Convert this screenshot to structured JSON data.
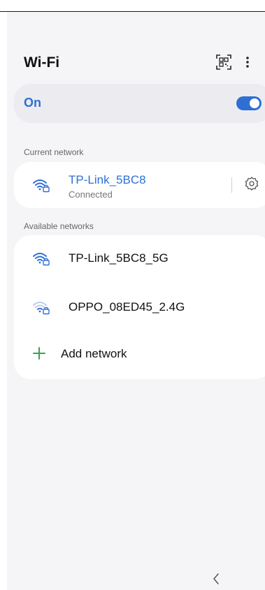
{
  "header": {
    "title": "Wi-Fi",
    "qr_icon": "qr-code-scan-icon",
    "more_icon": "more-vertical-icon"
  },
  "wifi_toggle": {
    "label": "On",
    "state": "on",
    "accent": "#2f6fd3"
  },
  "current_network": {
    "section_label": "Current network",
    "name": "TP-Link_5BC8",
    "status": "Connected",
    "icon": "wifi-lock-icon",
    "settings_icon": "gear-icon"
  },
  "available_networks": {
    "section_label": "Available networks",
    "items": [
      {
        "name": "TP-Link_5BC8_5G",
        "icon": "wifi-lock-icon"
      },
      {
        "name": "OPPO_08ED45_2.4G",
        "icon": "wifi-lock-weak-icon"
      }
    ],
    "add_label": "Add network",
    "add_icon": "plus-icon",
    "add_color": "#2fa84f"
  },
  "nav": {
    "back_icon": "back-chevron-icon"
  }
}
